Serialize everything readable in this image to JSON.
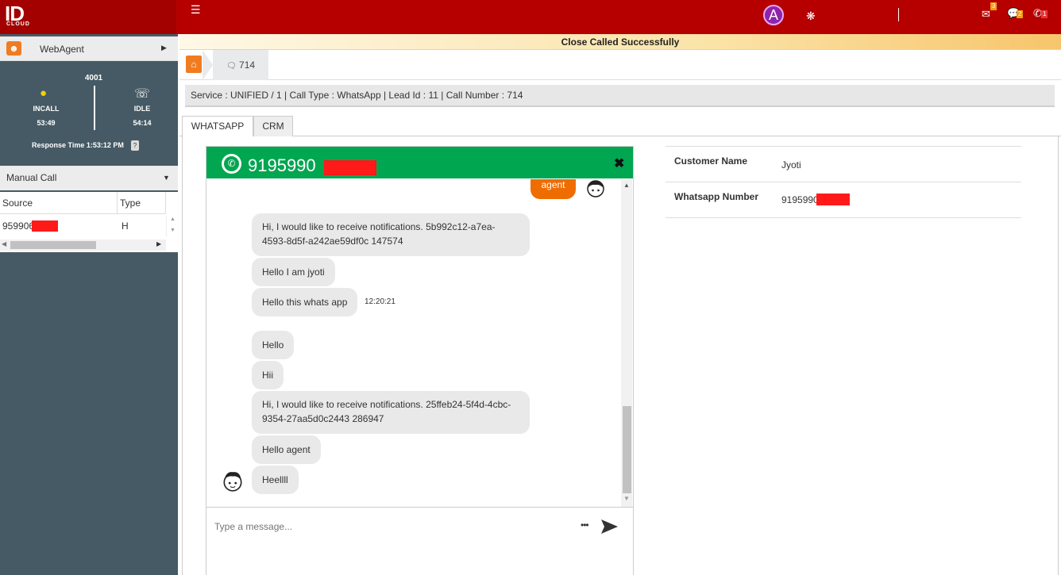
{
  "header": {
    "logo_text": "ID",
    "logo_sub": "CLOUD",
    "avatar_letter": "A",
    "mail_count": "3",
    "chat_count": "2",
    "call_count": "1",
    "brand_color": "#b60000"
  },
  "notification": "Close Called Successfully",
  "sidebar": {
    "webagent_label": "WebAgent",
    "extension": "4001",
    "incall_label": "INCALL",
    "incall_time": "53:49",
    "idle_label": "IDLE",
    "idle_time": "54:14",
    "response_time": "Response Time 1:53:12 PM",
    "response_badge": "?",
    "manual_call_label": "Manual Call",
    "table": {
      "columns": [
        "Source",
        "Type"
      ],
      "rows": [
        {
          "source": "959906",
          "type": "H"
        }
      ]
    }
  },
  "breadcrumb": {
    "item_label": "714"
  },
  "info_bar": "Service : UNIFIED / 1 | Call Type : WhatsApp | Lead Id : 11 | Call Number : 714",
  "tabs": [
    "WHATSAPP",
    "CRM"
  ],
  "chat": {
    "phone": "9195990",
    "agent_label": "agent",
    "messages": [
      "Hi, I would like to receive notifications. 5b992c12-a7ea-",
      "4593-8d5f-a242ae59df0c 147574",
      "Hello I am jyoti",
      "Hello this whats app",
      "Hello",
      "Hii",
      "Hi, I would like to receive notifications. 25ffeb24-5f4d-4cbc-",
      "9354-27aa5d0c2443 286947",
      "Hello agent",
      "Heellll"
    ],
    "timestamp": "12:20:21",
    "input_placeholder": "Type a message...",
    "more_label": "•••"
  },
  "customer": {
    "name_label": "Customer Name",
    "name_value": "Jyoti",
    "number_label": "Whatsapp Number",
    "number_value": "9195990"
  }
}
